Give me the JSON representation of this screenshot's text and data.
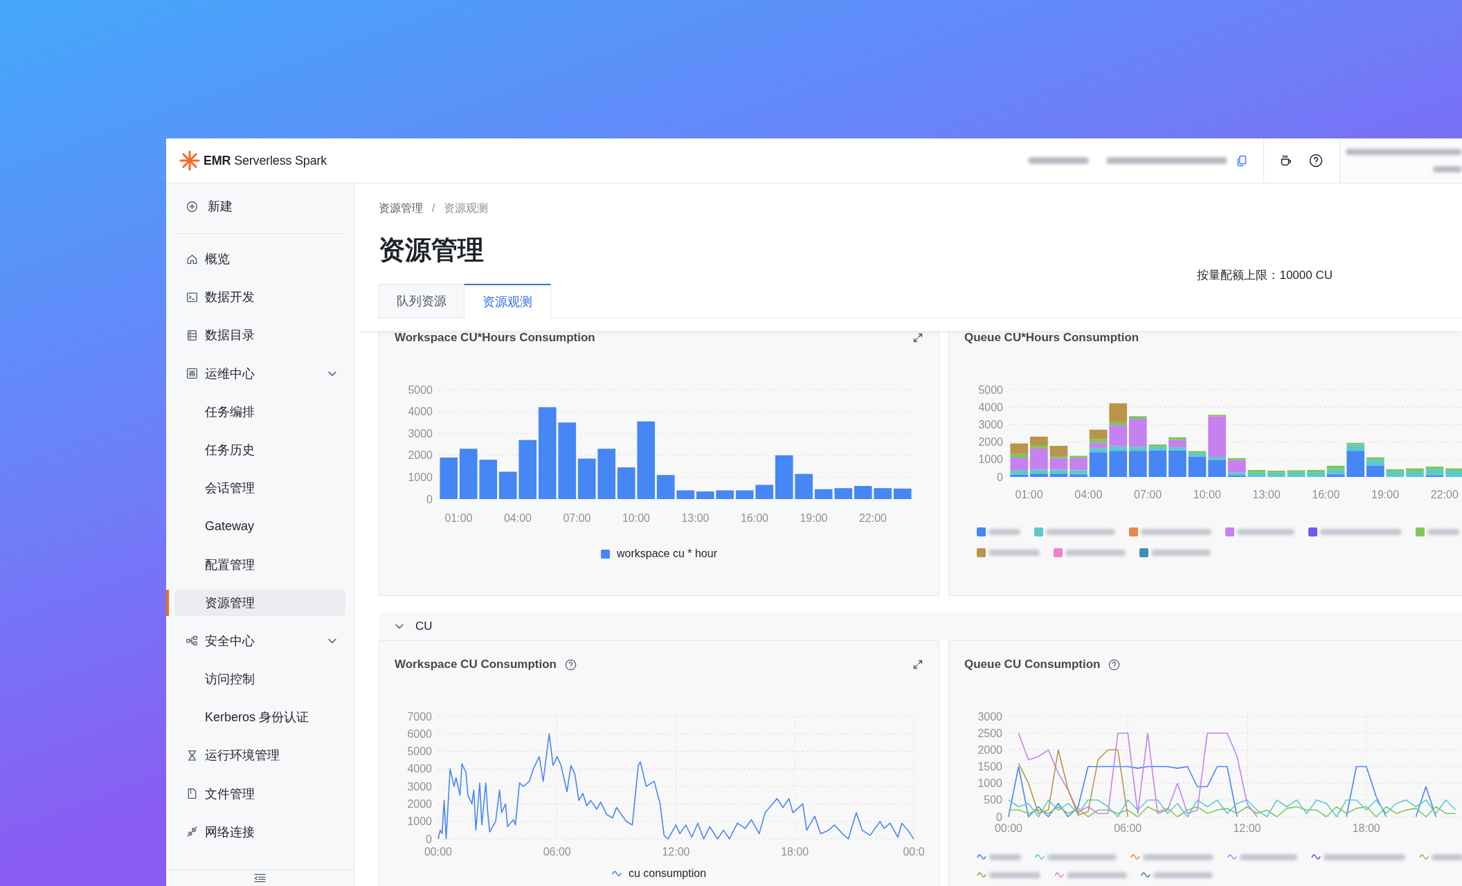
{
  "header": {
    "product_name": "**EMR** Serverless Spark"
  },
  "sidebar": {
    "new_button": "新建",
    "items": [
      {
        "label": "概览",
        "selected": false
      },
      {
        "label": "数据开发",
        "selected": false
      },
      {
        "label": "数据目录",
        "selected": false
      },
      {
        "label": "运维中心",
        "selected": false,
        "expanded": true,
        "children": [
          {
            "label": "任务编排",
            "selected": false
          },
          {
            "label": "任务历史",
            "selected": false
          },
          {
            "label": "会话管理",
            "selected": false
          },
          {
            "label": "Gateway",
            "selected": false
          },
          {
            "label": "配置管理",
            "selected": false
          },
          {
            "label": "资源管理",
            "selected": true
          }
        ]
      },
      {
        "label": "安全中心",
        "selected": false,
        "expanded": true,
        "children": [
          {
            "label": "访问控制",
            "selected": false
          },
          {
            "label": "Kerberos 身份认证",
            "selected": false
          }
        ]
      },
      {
        "label": "运行环境管理",
        "selected": false
      },
      {
        "label": "文件管理",
        "selected": false
      },
      {
        "label": "网络连接",
        "selected": false
      }
    ]
  },
  "breadcrumb": {
    "items": [
      "资源管理",
      "资源观测"
    ],
    "separator": "/"
  },
  "page_title": "资源管理",
  "quota": "按量配额上限：10000 CU",
  "tabs": [
    {
      "label": "队列资源",
      "selected": false
    },
    {
      "label": "资源观测",
      "selected": true
    }
  ],
  "cards": [
    {
      "title": "Workspace CU*Hours Consumption",
      "help": false,
      "expandable": true,
      "chart_data": {
        "type": "bar",
        "grid": true,
        "x": [
          0.5,
          1.5,
          2.5,
          3.5,
          4.5,
          5.5,
          6.5,
          7.5,
          8.5,
          9.5,
          10.5,
          11.5,
          12.5,
          13.5,
          14.5,
          15.5,
          16.5,
          17.5,
          18.5,
          19.5,
          20.5,
          21.5,
          22.5,
          23.5
        ],
        "xlim": [
          0,
          24
        ],
        "xticks": [
          {
            "value": 1,
            "label": "01:00"
          },
          {
            "value": 4,
            "label": "04:00"
          },
          {
            "value": 7,
            "label": "07:00"
          },
          {
            "value": 10,
            "label": "10:00"
          },
          {
            "value": 13,
            "label": "13:00"
          },
          {
            "value": 16,
            "label": "16:00"
          },
          {
            "value": 19,
            "label": "19:00"
          },
          {
            "value": 22,
            "label": "22:00"
          }
        ],
        "ylim": [
          0,
          5000
        ],
        "yticks": [
          0,
          1000,
          2000,
          3000,
          4000,
          5000
        ],
        "series": [
          {
            "name": "workspace cu * hour",
            "color": "#4686f5",
            "values": [
              1900,
              2300,
              1800,
              1250,
              2700,
              4200,
              3500,
              1850,
              2300,
              1450,
              3550,
              1100,
              400,
              350,
              400,
              400,
              650,
              2000,
              1150,
              450,
              500,
              600,
              500,
              480
            ]
          }
        ]
      }
    },
    {
      "title": "Queue CU*Hours Consumption",
      "help": false,
      "expandable": false,
      "chart_data": {
        "type": "bar",
        "grid": true,
        "stacked": true,
        "x": [
          0.5,
          1.5,
          2.5,
          3.5,
          4.5,
          5.5,
          6.5,
          7.5,
          8.5,
          9.5,
          10.5,
          11.5,
          12.5,
          13.5,
          14.5,
          15.5,
          16.5,
          17.5,
          18.5,
          19.5,
          20.5,
          21.5,
          22.5
        ],
        "xlim": [
          0,
          24
        ],
        "xticks": [
          {
            "value": 1,
            "label": "01:00"
          },
          {
            "value": 4,
            "label": "04:00"
          },
          {
            "value": 7,
            "label": "07:00"
          },
          {
            "value": 10,
            "label": "10:00"
          },
          {
            "value": 13,
            "label": "13:00"
          },
          {
            "value": 16,
            "label": "16:00"
          },
          {
            "value": 19,
            "label": "19:00"
          },
          {
            "value": 22,
            "label": "22:00"
          }
        ],
        "ylim": [
          0,
          5000
        ],
        "yticks": [
          0,
          1000,
          2000,
          3000,
          4000,
          5000
        ],
        "series": [
          {
            "color": "#4686f5",
            "values": [
              130,
              190,
              190,
              150,
              1420,
              1500,
              1500,
              1520,
              1520,
              1170,
              980,
              80,
              0,
              0,
              0,
              0,
              150,
              1500,
              660,
              0,
              0,
              80,
              0
            ]
          },
          {
            "color": "#5ccaca",
            "values": [
              260,
              230,
              230,
              230,
              250,
              260,
              240,
              220,
              180,
              210,
              170,
              170,
              250,
              250,
              280,
              270,
              300,
              340,
              320,
              320,
              320,
              360,
              360
            ]
          },
          {
            "color": "#e8894c",
            "values": [
              0,
              0,
              0,
              0,
              0,
              0,
              0,
              0,
              0,
              0,
              0,
              0,
              0,
              0,
              0,
              0,
              0,
              0,
              0,
              0,
              0,
              0,
              0
            ]
          },
          {
            "color": "#c680f0",
            "values": [
              720,
              1210,
              660,
              720,
              300,
              1210,
              1590,
              0,
              420,
              0,
              2320,
              720,
              0,
              0,
              0,
              0,
              0,
              0,
              0,
              0,
              0,
              0,
              0
            ]
          },
          {
            "color": "#6b5cf0",
            "values": [
              0,
              0,
              0,
              0,
              0,
              0,
              0,
              0,
              0,
              0,
              0,
              0,
              0,
              0,
              0,
              0,
              0,
              0,
              0,
              0,
              0,
              0,
              0
            ]
          },
          {
            "color": "#7dc75a",
            "values": [
              210,
              150,
              110,
              110,
              190,
              170,
              150,
              120,
              150,
              100,
              90,
              110,
              150,
              110,
              100,
              130,
              190,
              110,
              140,
              120,
              170,
              150,
              130
            ]
          },
          {
            "color": "#b8954a",
            "values": [
              600,
              530,
              590,
              0,
              550,
              1080,
              0,
              0,
              0,
              0,
              0,
              0,
              0,
              0,
              0,
              0,
              0,
              0,
              0,
              0,
              0,
              0,
              0
            ]
          },
          {
            "color": "#f07fcc",
            "values": [
              0,
              0,
              0,
              0,
              0,
              0,
              0,
              0,
              0,
              0,
              0,
              0,
              0,
              0,
              0,
              0,
              0,
              0,
              0,
              0,
              0,
              0,
              0
            ]
          },
          {
            "color": "#3b8fb2",
            "values": [
              0,
              0,
              0,
              0,
              0,
              0,
              0,
              0,
              0,
              0,
              0,
              0,
              0,
              0,
              0,
              0,
              0,
              0,
              0,
              0,
              0,
              0,
              0
            ]
          }
        ]
      }
    }
  ],
  "cu_section": {
    "label": "CU",
    "expanded": true,
    "cards": [
      {
        "title": "Workspace CU Consumption",
        "help": true,
        "expandable": true,
        "chart_data": {
          "type": "line",
          "grid": true,
          "x": [
            0,
            0.1,
            0.2,
            0.3,
            0.4,
            0.6,
            0.8,
            0.9,
            1.1,
            1.2,
            1.4,
            1.5,
            1.7,
            1.8,
            1.9,
            2.1,
            2.2,
            2.4,
            2.5,
            2.6,
            2.9,
            3.1,
            3.2,
            3.4,
            3.5,
            3.8,
            3.9,
            4.1,
            4.3,
            4.6,
            4.8,
            5.1,
            5.3,
            5.6,
            5.8,
            6.0,
            6.2,
            6.5,
            6.7,
            6.9,
            7.1,
            7.3,
            7.5,
            7.7,
            8.0,
            8.2,
            8.5,
            8.8,
            9.0,
            9.3,
            9.5,
            9.8,
            10.1,
            10.2,
            10.5,
            10.9,
            11.2,
            11.4,
            11.6,
            12.0,
            12.2,
            12.5,
            12.8,
            13.1,
            13.4,
            13.7,
            14.1,
            14.4,
            14.7,
            15.1,
            15.5,
            15.8,
            16.2,
            16.5,
            17.1,
            17.4,
            17.7,
            17.9,
            18.4,
            18.6,
            19.0,
            19.3,
            19.7,
            20.0,
            20.4,
            20.7,
            21.1,
            21.4,
            21.8,
            22.3,
            22.5,
            22.8,
            23.2,
            23.4,
            23.7,
            24.0
          ],
          "xlim": [
            0,
            24
          ],
          "xticks": [
            {
              "value": 0,
              "label": "00:00"
            },
            {
              "value": 6,
              "label": "06:00"
            },
            {
              "value": 12,
              "label": "12:00"
            },
            {
              "value": 18,
              "label": "18:00"
            },
            {
              "value": 24,
              "label": "00:0"
            }
          ],
          "ylim": [
            0,
            7000
          ],
          "yticks": [
            0,
            1000,
            2000,
            3000,
            4000,
            5000,
            6000,
            7000
          ],
          "series": [
            {
              "name": "cu consumption",
              "color": "#4686f5",
              "values": [
                0,
                500,
                300,
                2200,
                0,
                4000,
                3000,
                3500,
                2500,
                4300,
                3800,
                2500,
                2000,
                2800,
                500,
                3200,
                800,
                3200,
                1500,
                400,
                1000,
                2800,
                1500,
                2000,
                700,
                1100,
                800,
                3200,
                3000,
                3300,
                4000,
                4700,
                3300,
                6000,
                4200,
                4700,
                4200,
                2700,
                4200,
                3700,
                2200,
                2600,
                1900,
                2200,
                1700,
                2100,
                1400,
                1200,
                1800,
                1300,
                1000,
                800,
                4200,
                4400,
                3000,
                3300,
                2000,
                200,
                0,
                800,
                300,
                800,
                100,
                900,
                0,
                700,
                0,
                500,
                0,
                900,
                600,
                1100,
                300,
                1500,
                2300,
                1800,
                2300,
                1500,
                2000,
                500,
                1300,
                300,
                500,
                800,
                300,
                0,
                1500,
                500,
                200,
                1000,
                600,
                900,
                100,
                900,
                500,
                0
              ]
            }
          ]
        }
      },
      {
        "title": "Queue CU Consumption",
        "help": true,
        "expandable": false,
        "chart_data": {
          "type": "line",
          "grid": true,
          "x": [
            0,
            0.5,
            1,
            1.5,
            2,
            2.5,
            3,
            3.5,
            4,
            4.5,
            5,
            5.5,
            6,
            6.5,
            7,
            7.5,
            8,
            8.5,
            9,
            9.5,
            10,
            10.5,
            11,
            11.5,
            12,
            12.5,
            13,
            13.5,
            14,
            14.5,
            15,
            15.5,
            16,
            16.5,
            17,
            17.5,
            18,
            18.5,
            19,
            19.5,
            20,
            20.5,
            21,
            21.5,
            22,
            22.5
          ],
          "xlim": [
            0,
            24
          ],
          "xticks": [
            {
              "value": 0,
              "label": "00:00"
            },
            {
              "value": 6,
              "label": "06:00"
            },
            {
              "value": 12,
              "label": "12:00"
            },
            {
              "value": 18,
              "label": "18:00"
            }
          ],
          "ylim": [
            0,
            3000
          ],
          "yticks": [
            0,
            500,
            1000,
            1500,
            2000,
            2500,
            3000
          ],
          "series": [
            {
              "color": "#4686f5",
              "values": [
                0,
                1500,
                0,
                300,
                0,
                400,
                0,
                300,
                1500,
                1500,
                1500,
                1500,
                1500,
                1450,
                1500,
                1500,
                1500,
                1450,
                1500,
                900,
                900,
                1500,
                1500,
                0,
                null,
                null,
                null,
                null,
                null,
                null,
                null,
                null,
                null,
                null,
                0,
                1500,
                1500,
                600,
                0,
                null,
                null,
                0,
                900,
                0,
                null,
                null
              ]
            },
            {
              "color": "#5ccaca",
              "values": [
                500,
                300,
                400,
                0,
                500,
                200,
                400,
                100,
                500,
                500,
                300,
                0,
                500,
                200,
                500,
                500,
                100,
                400,
                0,
                500,
                300,
                500,
                100,
                400,
                500,
                200,
                0,
                500,
                300,
                500,
                100,
                500,
                400,
                0,
                500,
                500,
                200,
                500,
                100,
                400,
                500,
                300,
                500,
                100,
                500,
                200
              ]
            },
            {
              "color": "#e8894c",
              "values": [
                null,
                null,
                null,
                null,
                null,
                null,
                null,
                null,
                null,
                null,
                null,
                null,
                null,
                null,
                null,
                null,
                null,
                null,
                null,
                null,
                null,
                null,
                null,
                null,
                null,
                null,
                null,
                null,
                null,
                null,
                null,
                null,
                null,
                null,
                null,
                null,
                null,
                null,
                null,
                null,
                null,
                null,
                null,
                null,
                null,
                null
              ]
            },
            {
              "color": "#c680f0",
              "values": [
                null,
                2500,
                1700,
                1800,
                2000,
                1300,
                800,
                150,
                300,
                100,
                100,
                2500,
                2500,
                100,
                2500,
                100,
                200,
                1000,
                100,
                200,
                2500,
                2500,
                2500,
                1800,
                400,
                0,
                null,
                null,
                null,
                null,
                null,
                null,
                null,
                null,
                null,
                null,
                null,
                null,
                null,
                null,
                null,
                null,
                null,
                null,
                null,
                null
              ]
            },
            {
              "color": "#6b5cf0",
              "values": [
                null,
                null,
                null,
                null,
                null,
                null,
                null,
                null,
                null,
                null,
                null,
                null,
                null,
                null,
                null,
                null,
                null,
                null,
                null,
                null,
                null,
                null,
                null,
                null,
                null,
                null,
                null,
                null,
                null,
                null,
                null,
                null,
                null,
                null,
                null,
                null,
                null,
                null,
                null,
                null,
                null,
                null,
                null,
                null,
                null,
                null
              ]
            },
            {
              "color": "#7dc75a",
              "values": [
                200,
                200,
                100,
                200,
                100,
                300,
                100,
                250,
                0,
                200,
                200,
                100,
                200,
                0,
                300,
                150,
                250,
                0,
                200,
                300,
                100,
                200,
                250,
                100,
                300,
                100,
                200,
                0,
                250,
                300,
                200,
                200,
                0,
                300,
                100,
                250,
                300,
                0,
                300,
                100,
                200,
                250,
                0,
                300,
                100,
                100
              ]
            },
            {
              "color": "#b8954a",
              "values": [
                null,
                1600,
                1000,
                100,
                200,
                2000,
                800,
                50,
                150,
                1700,
                2000,
                2000,
                0,
                null,
                null,
                null,
                null,
                null,
                null,
                null,
                null,
                null,
                null,
                null,
                null,
                null,
                null,
                null,
                null,
                null,
                null,
                null,
                null,
                null,
                null,
                null,
                null,
                null,
                null,
                null,
                null,
                null,
                null,
                null,
                null,
                null
              ]
            },
            {
              "color": "#f07fcc",
              "values": [
                null,
                null,
                null,
                null,
                null,
                null,
                null,
                null,
                null,
                null,
                null,
                null,
                null,
                null,
                null,
                null,
                null,
                null,
                null,
                null,
                null,
                null,
                null,
                null,
                null,
                null,
                null,
                null,
                null,
                null,
                null,
                null,
                null,
                null,
                null,
                null,
                null,
                null,
                null,
                null,
                null,
                null,
                null,
                null,
                null,
                null
              ]
            },
            {
              "color": "#3b8fb2",
              "values": [
                null,
                null,
                null,
                null,
                null,
                null,
                null,
                null,
                null,
                null,
                null,
                null,
                null,
                null,
                null,
                null,
                null,
                null,
                null,
                null,
                null,
                null,
                null,
                null,
                null,
                null,
                null,
                null,
                null,
                null,
                null,
                null,
                null,
                null,
                null,
                null,
                null,
                null,
                null,
                null,
                null,
                null,
                null,
                null,
                null,
                null
              ]
            }
          ]
        }
      }
    ]
  }
}
